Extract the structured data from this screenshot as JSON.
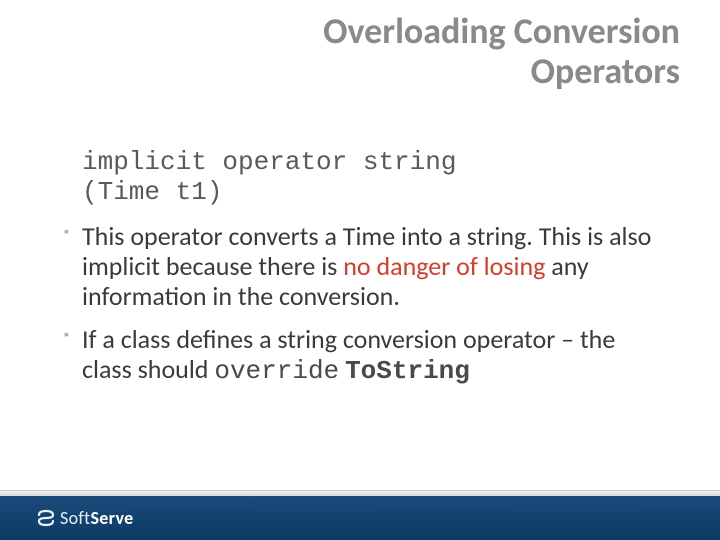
{
  "title_line1": "Overloading Conversion",
  "title_line2": "Operators",
  "code_line1": "implicit operator string",
  "code_line2": "(Time t1)",
  "bullet1_a": "This operator converts a Time into a string. This is also implicit because there is ",
  "bullet1_red": "no danger of losing",
  "bullet1_b": " any information in the conversion.",
  "bullet2_a": "If a class defines a string conversion operator – the class should ",
  "bullet2_mono": "override",
  "bullet2_bold": "ToString",
  "logo_soft": "Soft",
  "logo_serve": "Serve"
}
